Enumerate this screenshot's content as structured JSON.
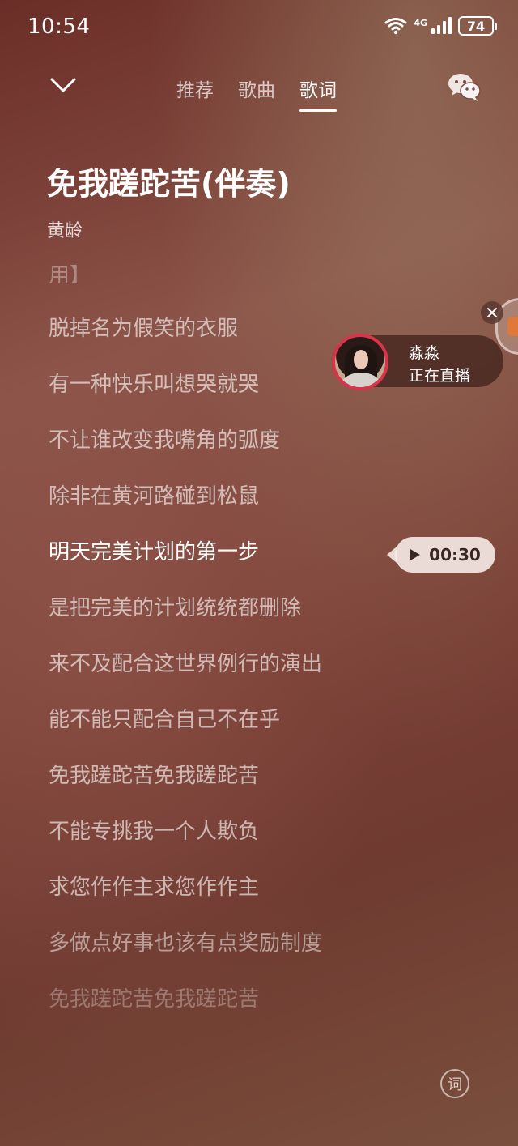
{
  "status_bar": {
    "time": "10:54",
    "network": "4G",
    "battery": "74"
  },
  "nav": {
    "tabs": [
      {
        "label": "推荐"
      },
      {
        "label": "歌曲"
      },
      {
        "label": "歌词"
      }
    ],
    "active_tab": "歌词",
    "icons": [
      "chevron-down-icon",
      "wechat-icon"
    ]
  },
  "song": {
    "title": "免我蹉跎苦(伴奏)",
    "artist": "黄龄"
  },
  "lyrics": {
    "cut_line": "用】",
    "lines": [
      "脱掉名为假笑的衣服",
      "有一种快乐叫想哭就哭",
      "不让谁改变我嘴角的弧度",
      "除非在黄河路碰到松鼠",
      "明天完美计划的第一步",
      "是把完美的计划统统都删除",
      "来不及配合这世界例行的演出",
      "能不能只配合自己不在乎",
      "免我蹉跎苦免我蹉跎苦",
      "不能专挑我一个人欺负",
      "求您作作主求您作作主",
      "多做点好事也该有点奖励制度",
      "免我蹉跎苦免我蹉跎苦"
    ],
    "current_index": 4
  },
  "live": {
    "name": "淼淼",
    "status": "正在直播"
  },
  "seek": {
    "time": "00:30"
  },
  "lyric_toggle": {
    "label": "词"
  },
  "colors": {
    "live_ring": "#d8344a",
    "pill_bg": "#f5ebe8"
  }
}
